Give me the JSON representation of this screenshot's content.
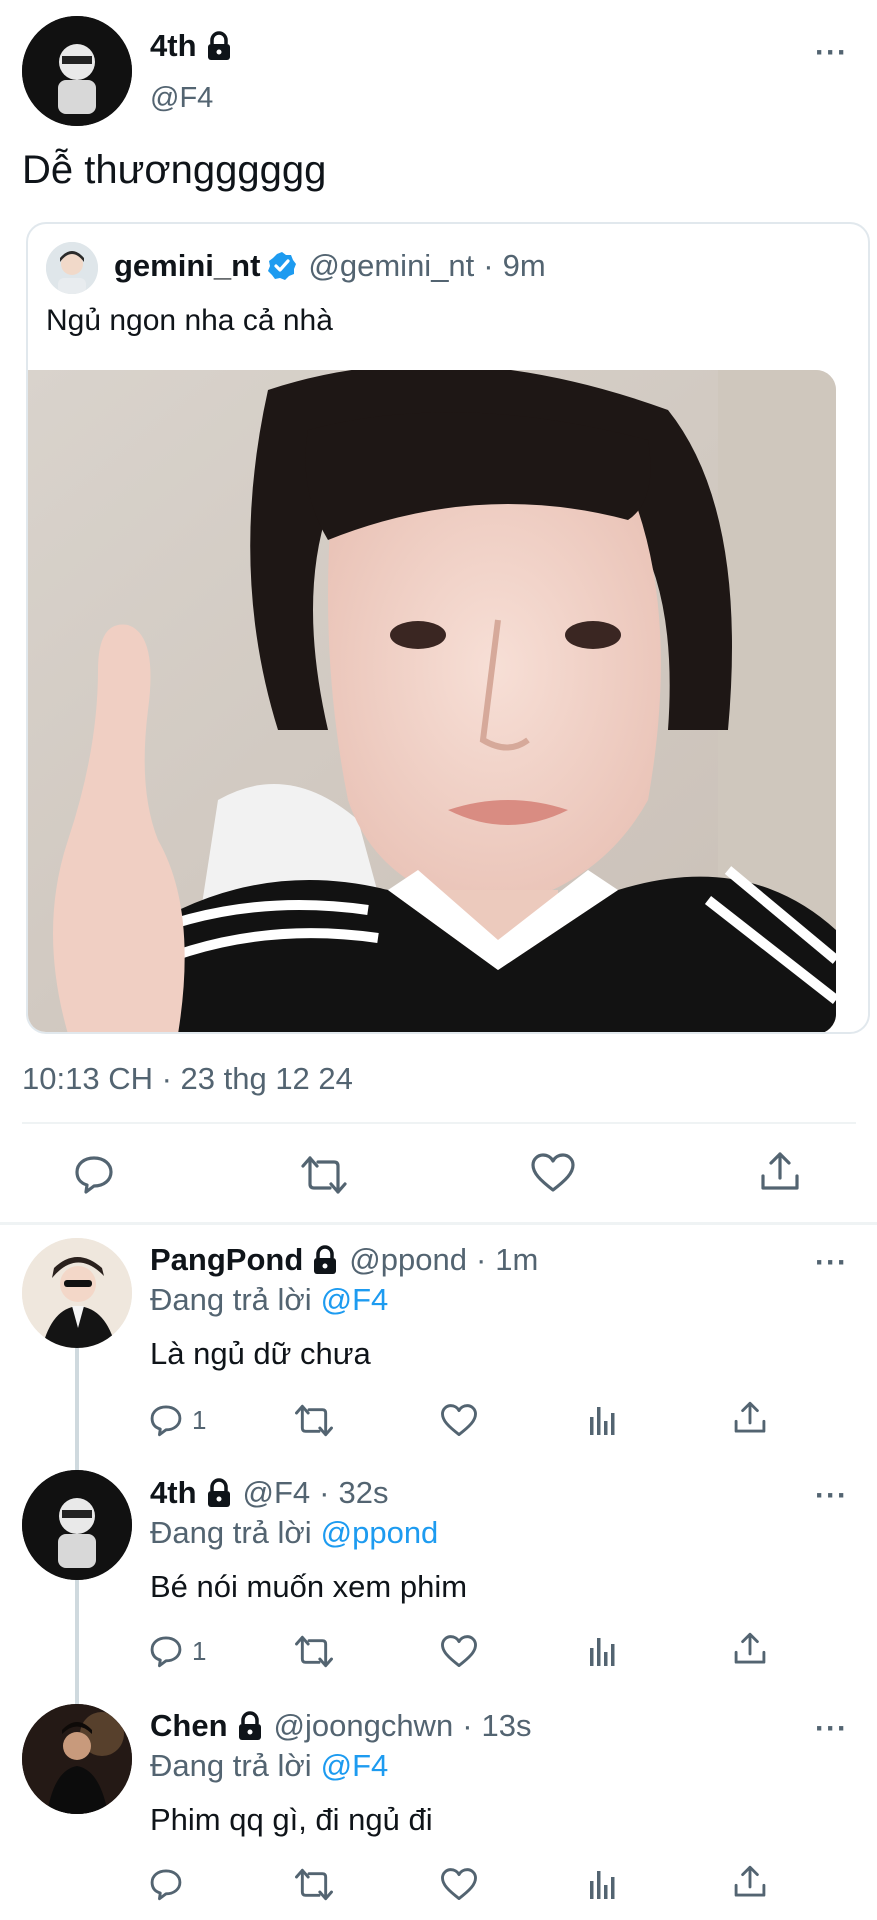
{
  "main_tweet": {
    "author_name": "4th",
    "author_handle": "@F4",
    "author_icon": "lock-icon",
    "text": "Dễ thươngggggg",
    "timestamp": "10:13 CH · 23 thg 12 24",
    "more_label": "···"
  },
  "quoted_tweet": {
    "author_name": "gemini_nt",
    "author_handle": "@gemini_nt",
    "verified_icon": "verified-badge-icon",
    "separator": "·",
    "time": "9m",
    "text": "Ngủ ngon nha cả nhà"
  },
  "main_actions": [
    "reply-icon",
    "retweet-icon",
    "like-icon",
    "share-icon"
  ],
  "replies": [
    {
      "name": "PangPond",
      "handle": "@ppond",
      "time": "1m",
      "replying_prefix": "Đang trả lời",
      "replying_to": "@F4",
      "text": "Là ngủ dữ chưa",
      "reply_count": "1"
    },
    {
      "name": "4th",
      "handle": "@F4",
      "time": "32s",
      "replying_prefix": "Đang trả lời",
      "replying_to": "@ppond",
      "text": "Bé nói muốn xem phim",
      "reply_count": "1"
    },
    {
      "name": "Chen",
      "handle": "@joongchwn",
      "time": "13s",
      "replying_prefix": "Đang trả lời",
      "replying_to": "@F4",
      "text": "Phim qq gì, đi ngủ đi",
      "reply_count": ""
    }
  ],
  "colors": {
    "accent": "#1d9bf0",
    "text": "#0f1419",
    "muted": "#536471",
    "divider": "#eff3f4"
  }
}
